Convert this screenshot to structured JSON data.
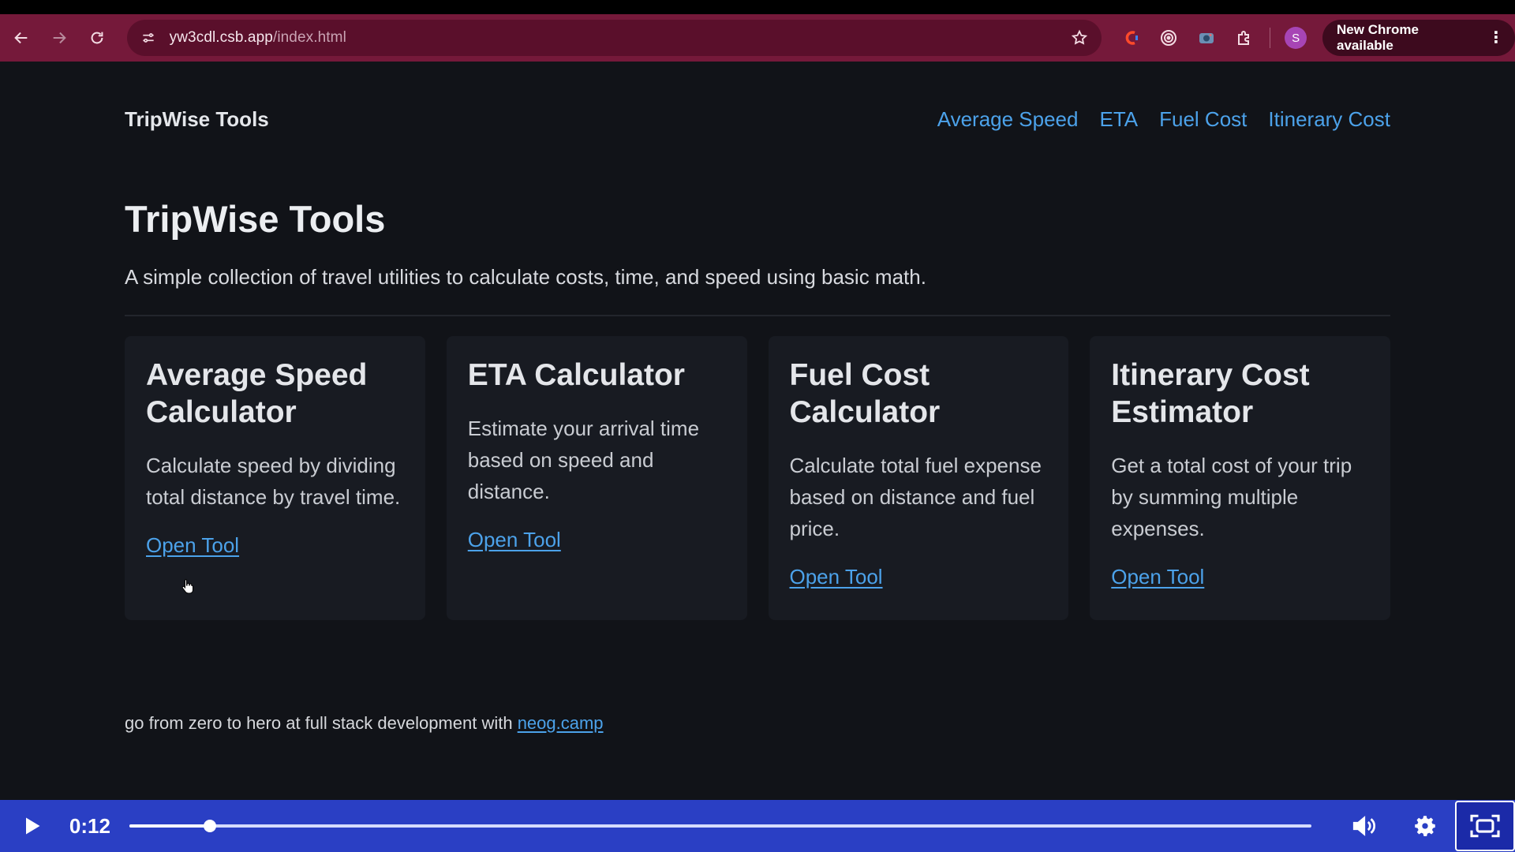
{
  "browser": {
    "url_host": "yw3cdl.csb.app",
    "url_path": "/index.html",
    "profile_initial": "S",
    "update_label": "New Chrome available"
  },
  "site": {
    "brand": "TripWise Tools",
    "nav": [
      "Average Speed",
      "ETA",
      "Fuel Cost",
      "Itinerary Cost"
    ]
  },
  "hero": {
    "title": "TripWise Tools",
    "description": "A simple collection of travel utilities to calculate costs, time, and speed using basic math."
  },
  "cards": [
    {
      "title": "Average Speed Calculator",
      "description": "Calculate speed by dividing total distance by travel time.",
      "link": "Open Tool"
    },
    {
      "title": "ETA Calculator",
      "description": "Estimate your arrival time based on speed and distance.",
      "link": "Open Tool"
    },
    {
      "title": "Fuel Cost Calculator",
      "description": "Calculate total fuel expense based on distance and fuel price.",
      "link": "Open Tool"
    },
    {
      "title": "Itinerary Cost Estimator",
      "description": "Get a total cost of your trip by summing multiple expenses.",
      "link": "Open Tool"
    }
  ],
  "footer": {
    "text": "go from zero to hero at full stack development with ",
    "link": "neog.camp"
  },
  "video": {
    "time": "0:12",
    "progress_fraction": 0.068
  },
  "colors": {
    "accent": "#4ca2ea",
    "browser_frame": "#75193a",
    "video_bar": "#2a3fc4"
  }
}
